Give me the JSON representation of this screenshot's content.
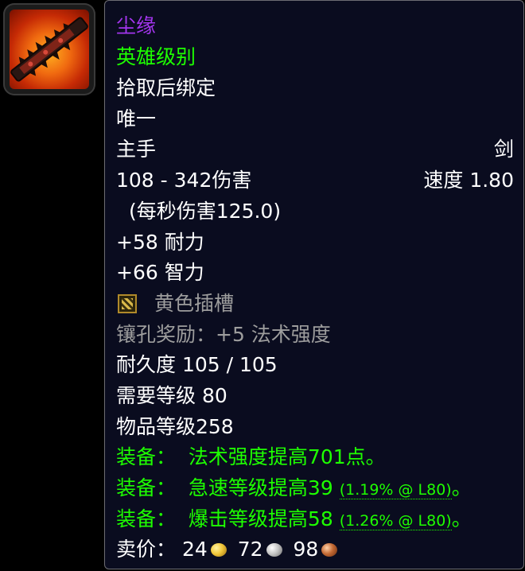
{
  "item": {
    "icon": "sword-item-icon",
    "name": "尘缘",
    "quality": "英雄级别",
    "binding": "拾取后绑定",
    "unique": "唯一",
    "slot": "主手",
    "weapon_type": "剑",
    "damage": "108 - 342伤害",
    "speed": "速度 1.80",
    "dps": "(每秒伤害125.0)",
    "stats": [
      "+58 耐力",
      "+66 智力"
    ],
    "socket": "黄色插槽",
    "socket_bonus": "镶孔奖励：+5 法术强度",
    "durability": "耐久度 105 / 105",
    "required_level": "需要等级 80",
    "item_level": "物品等级258",
    "equip_effects": [
      {
        "label": "装备：",
        "text": "法术强度提高701点。",
        "detail": "",
        "end": ""
      },
      {
        "label": "装备：",
        "text": "急速等级提高39",
        "detail": "(1.19% @ L80)",
        "end": "。"
      },
      {
        "label": "装备：",
        "text": "爆击等级提高58",
        "detail": "(1.26% @ L80)",
        "end": "。"
      }
    ],
    "sell_price": {
      "label": "卖价：",
      "gold": "24",
      "silver": "72",
      "copper": "98"
    }
  },
  "colors": {
    "epic_purple": "#a335ee",
    "equip_green": "#1eff00",
    "socket_gray": "#9d9d9d",
    "background": "#0a0c1f",
    "border": "#6d6d73"
  }
}
